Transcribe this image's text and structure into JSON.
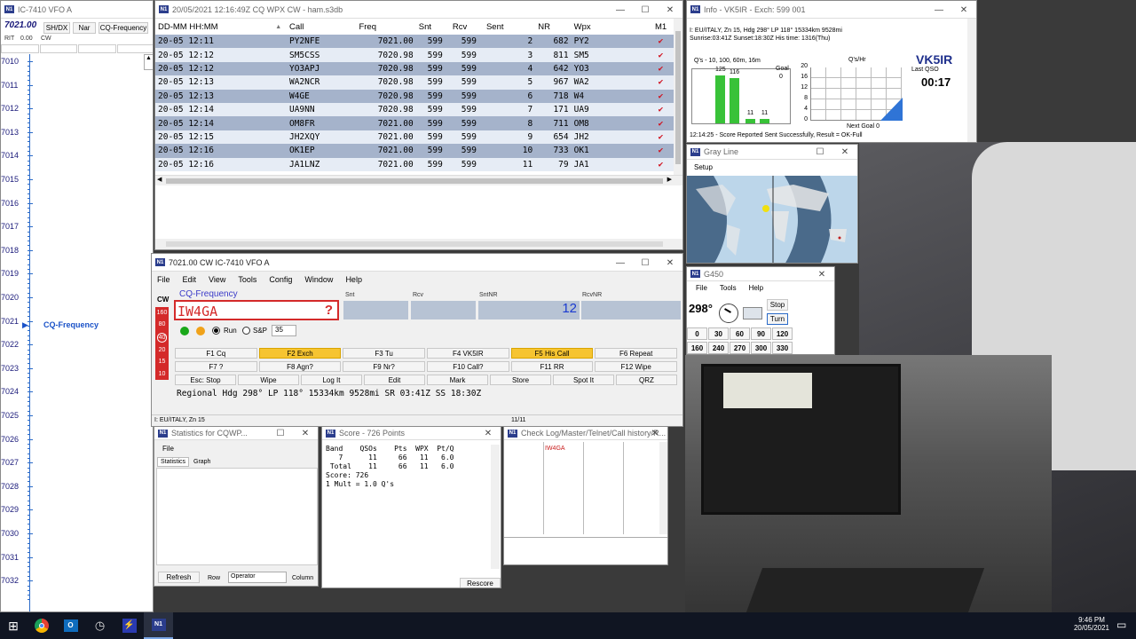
{
  "bandmap": {
    "title": "IC-7410 VFO A",
    "freq": "7021.00",
    "btn_mode": "SH/DX",
    "btn_nar": "Nar",
    "btn_cq": "CQ-Frequency",
    "rit_label": "RIT",
    "rit_value": "0.00",
    "mode": "CW",
    "freqs": [
      "7010",
      "7011",
      "7012",
      "7013",
      "7014",
      "7015",
      "7016",
      "7017",
      "7018",
      "7019",
      "7020",
      "7021",
      "7022",
      "7023",
      "7024",
      "7025",
      "7026",
      "7027",
      "7028",
      "7029",
      "7030",
      "7031",
      "7032"
    ],
    "marker_label": "CQ-Frequency"
  },
  "log": {
    "title": "20/05/2021 12:16:49Z  CQ WPX  CW - ham.s3db",
    "headers": [
      "DD-MM HH:MM",
      "",
      "Call",
      "Freq",
      "Snt",
      "Rcv",
      "Sent",
      "NR",
      "Wpx",
      "M1"
    ],
    "rows": [
      [
        "20-05 12:11",
        "PY2NFE",
        "7021.00",
        "599",
        "599",
        "2",
        "682",
        "PY2"
      ],
      [
        "20-05 12:12",
        "SM5CSS",
        "7020.98",
        "599",
        "599",
        "3",
        "811",
        "SM5"
      ],
      [
        "20-05 12:12",
        "YO3APJ",
        "7020.98",
        "599",
        "599",
        "4",
        "642",
        "YO3"
      ],
      [
        "20-05 12:13",
        "WA2NCR",
        "7020.98",
        "599",
        "599",
        "5",
        "967",
        "WA2"
      ],
      [
        "20-05 12:13",
        "W4GE",
        "7020.98",
        "599",
        "599",
        "6",
        "718",
        "W4"
      ],
      [
        "20-05 12:14",
        "UA9NN",
        "7020.98",
        "599",
        "599",
        "7",
        "171",
        "UA9"
      ],
      [
        "20-05 12:14",
        "OM8FR",
        "7021.00",
        "599",
        "599",
        "8",
        "711",
        "OM8"
      ],
      [
        "20-05 12:15",
        "JH2XQY",
        "7021.00",
        "599",
        "599",
        "9",
        "654",
        "JH2"
      ],
      [
        "20-05 12:16",
        "OK1EP",
        "7021.00",
        "599",
        "599",
        "10",
        "733",
        "OK1"
      ],
      [
        "20-05 12:16",
        "JA1LNZ",
        "7021.00",
        "599",
        "599",
        "11",
        "79",
        "JA1"
      ]
    ],
    "sort_arrow": "▲",
    "checkmark": "✔"
  },
  "info": {
    "title": "Info - VK5IR - Exch: 599 001",
    "line1": "I: EU/ITALY, Zn 15, Hdg 298° LP 118° 15334km 9528mi",
    "line2": "Sunrise:03:41Z Sunset:18:30Z  His time: 1316(Thu)",
    "qs_label": "Q's - 10, 100, 60m, 16m",
    "bars": [
      125,
      116,
      11,
      11
    ],
    "goal_label": "Goal",
    "goal_value": "0",
    "qshr_label": "Q's/Hr",
    "y_ticks": [
      "20",
      "16",
      "12",
      "8",
      "4",
      "0"
    ],
    "next_goal": "Next Goal 0",
    "call": "VK5IR",
    "last_qso_label": "Last QSO",
    "last_qso_time": "00:17",
    "status": "12:14:25 - Score Reported Sent Successfully, Result = OK-Full"
  },
  "grayline": {
    "title": "Gray Line",
    "setup": "Setup"
  },
  "rotor": {
    "title": "G450",
    "menu": [
      "File",
      "Tools",
      "Help"
    ],
    "heading": "298°",
    "stop": "Stop",
    "turn": "Turn",
    "row1": [
      "0",
      "30",
      "60",
      "90",
      "120"
    ],
    "row2": [
      "160",
      "240",
      "270",
      "300",
      "330"
    ]
  },
  "entry": {
    "title": "7021.00 CW IC-7410 VFO A",
    "menu": [
      "File",
      "Edit",
      "View",
      "Tools",
      "Config",
      "Window",
      "Help"
    ],
    "mode": "CW",
    "status_label": "CQ-Frequency",
    "call_value": "IW4GA",
    "call_qmark": "?",
    "col_snt": "Snt",
    "col_rcv": "Rcv",
    "col_sntnr": "SntNR",
    "col_rcvnr": "RcvNR",
    "sntnr_value": "12",
    "bands": [
      "160",
      "80",
      "40",
      "20",
      "15",
      "10"
    ],
    "run_label": "Run",
    "sp_label": "S&P",
    "wpm": "35",
    "fkeys_row1": [
      "F1 Cq",
      "F2 Exch",
      "F3 Tu",
      "F4 VK5IR",
      "F5 His Call",
      "F6 Repeat"
    ],
    "fkeys_row2": [
      "F7 ?",
      "F8 Agn?",
      "F9 Nr?",
      "F10 Call?",
      "F11 RR",
      "F12 Wipe"
    ],
    "action_row": [
      "Esc: Stop",
      "Wipe",
      "Log It",
      "Edit",
      "Mark",
      "Store",
      "Spot It",
      "QRZ"
    ],
    "info_line": "Regional Hdg 298° LP 118° 15334km 9528mi SR 03:41Z SS 18:30Z",
    "status_left": "I: EU/ITALY, Zn 15",
    "status_count": "11/11"
  },
  "stats": {
    "title": "Statistics for CQWP...",
    "menu": "File",
    "tab1": "Statistics",
    "tab2": "Graph",
    "refresh": "Refresh",
    "row_label": "Row",
    "row_select": "Operator",
    "column_label": "Column"
  },
  "score": {
    "title": "Score - 726 Points",
    "header": "Band    QSOs    Pts  WPX  Pt/Q",
    "line1": "   7      11     66   11   6.0",
    "line2": " Total    11     66   11   6.0",
    "line3": "Score: 726",
    "line4": "1 Mult = 1.0 Q's",
    "rescore": "Rescore"
  },
  "checklog": {
    "title": "Check Log/Master/Telnet/Call history/R...",
    "entry": "IW4GA"
  },
  "taskbar": {
    "time": "9:46 PM",
    "date": "20/05/2021"
  }
}
